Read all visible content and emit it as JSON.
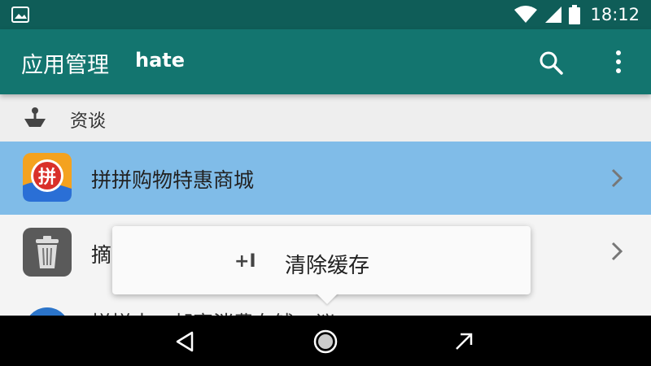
{
  "status_bar": {
    "time": "18:12",
    "icons": [
      "photo-icon",
      "wifi-icon",
      "signal-icon",
      "battery-icon"
    ]
  },
  "app_bar": {
    "title": "应用管理",
    "subtitle": "hate",
    "actions": [
      "search-icon",
      "more-vert-icon"
    ]
  },
  "section": {
    "label": "资谈",
    "icon": "scale-icon"
  },
  "list": {
    "items": [
      {
        "label": "拼拼购物特惠商城",
        "icon": "pinpin-app-icon",
        "icon_text": "拼",
        "selected": true
      },
      {
        "label": "摘",
        "icon": "trash-app-icon",
        "selected": false
      },
      {
        "label": "拼拼申、邮寄消费有钱、议",
        "icon": "circle-app-icon",
        "selected": false
      }
    ]
  },
  "popup_menu": {
    "icon_text": "+I",
    "label": "清除缓存"
  },
  "nav_bar": {
    "buttons": [
      "back-icon",
      "home-icon",
      "recent-apps-icon"
    ]
  },
  "colors": {
    "status_bar": "#0f5d58",
    "app_bar": "#13756f",
    "selected_row": "#80bce8",
    "nav_bar": "#000000"
  }
}
